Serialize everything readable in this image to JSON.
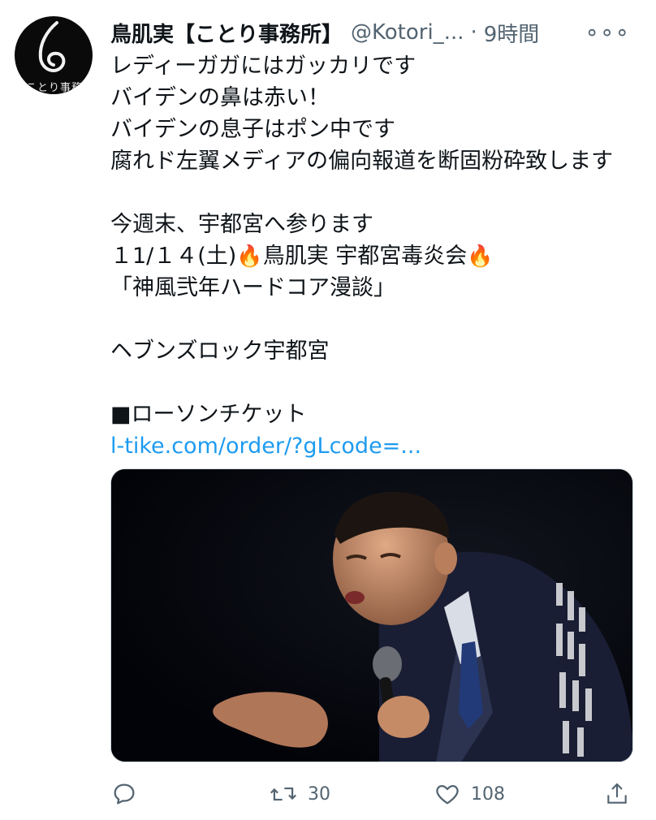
{
  "tweet": {
    "display_name": "鳥肌実【ことり事務所】",
    "handle": "@Kotori_...",
    "separator": "·",
    "time": "9時間",
    "more_icon": "more-horizontal-icon",
    "avatar_text": "ことり事務",
    "lines": [
      "レディーガガにはガッカリです",
      "バイデンの鼻は赤い！",
      "バイデンの息子はポン中です",
      "腐れド左翼メディアの偏向報道を断固粉砕致します",
      "",
      "今週末、宇都宮へ参ります",
      "",
      "「神風弐年ハードコア漫談」",
      "",
      "ヘブンズロック宇都宮",
      "",
      "■ローソンチケット"
    ],
    "event_line": {
      "date": "１1/１４(土)",
      "fire_emoji": "🔥",
      "title": "鳥肌実 宇都宮毒炎会"
    },
    "link": "l-tike.com/order/?gLcode=..."
  },
  "actions": {
    "reply": {
      "icon": "reply-icon",
      "count": ""
    },
    "retweet": {
      "icon": "retweet-icon",
      "count": "30"
    },
    "like": {
      "icon": "heart-icon",
      "count": "108"
    },
    "share": {
      "icon": "share-icon",
      "count": ""
    }
  },
  "colors": {
    "text": "#0f1419",
    "secondary": "#536471",
    "link": "#1d9bf0",
    "media_bg": "#04060c"
  }
}
